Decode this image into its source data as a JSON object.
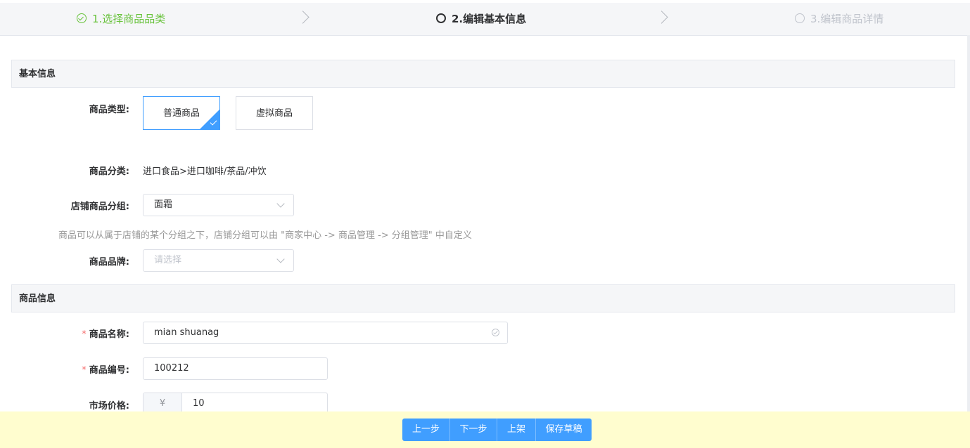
{
  "steps": [
    {
      "label": "1.选择商品品类",
      "state": "done"
    },
    {
      "label": "2.编辑基本信息",
      "state": "active"
    },
    {
      "label": "3.编辑商品详情",
      "state": "pending"
    }
  ],
  "basic_section": {
    "title": "基本信息"
  },
  "product_type": {
    "label": "商品类型:",
    "options": [
      "普通商品",
      "虚拟商品"
    ],
    "selected": "普通商品"
  },
  "category": {
    "label": "商品分类:",
    "value": "进口食品>进口咖啡/茶品/冲饮"
  },
  "store_group": {
    "label": "店铺商品分组:",
    "value": "面霜",
    "hint": "商品可以从属于店铺的某个分组之下，店铺分组可以由 \"商家中心 -> 商品管理 -> 分组管理\" 中自定义"
  },
  "brand": {
    "label": "商品品牌:",
    "placeholder": "请选择"
  },
  "info_section": {
    "title": "商品信息"
  },
  "product_name": {
    "required_mark": "*",
    "label": "商品名称:",
    "value": "mian shuanag"
  },
  "product_code": {
    "required_mark": "*",
    "label": "商品编号:",
    "value": "100212"
  },
  "market_price": {
    "label": "市场价格:",
    "prefix": "¥",
    "value": "10"
  },
  "actions": {
    "prev": "上一步",
    "next": "下一步",
    "shelve": "上架",
    "save_draft": "保存草稿"
  },
  "colors": {
    "primary": "#409eff",
    "success": "#67c23a",
    "required": "#f56c6c",
    "footer_bg": "#fffdcf"
  }
}
